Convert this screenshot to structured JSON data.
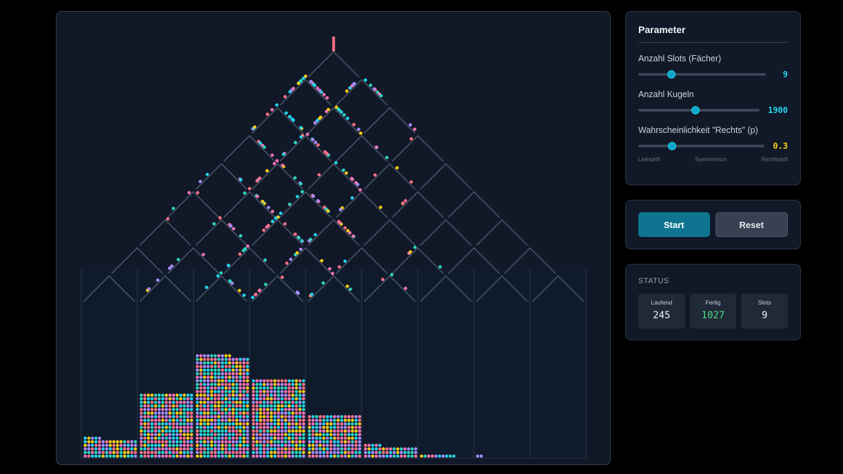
{
  "params": {
    "title": "Parameter",
    "slots": {
      "label": "Anzahl Slots (Fächer)",
      "value": "9",
      "fraction": 0.26
    },
    "balls": {
      "label": "Anzahl Kugeln",
      "value": "1900",
      "fraction": 0.47
    },
    "prob": {
      "label": "Wahrscheinlichkeit \"Rechts\" (p)",
      "value": "0.3",
      "fraction": 0.27
    },
    "drift": {
      "left": "Linksdrift",
      "center": "Symmetrisch",
      "right": "Rechtsdrift"
    }
  },
  "actions": {
    "start": "Start",
    "reset": "Reset"
  },
  "status": {
    "title": "STATUS",
    "running_label": "Laufend",
    "running": "245",
    "done_label": "Fertig",
    "done": "1027",
    "slots_label": "Slots",
    "slots": "9"
  },
  "sim": {
    "slot_counts": [
      80,
      270,
      430,
      330,
      180,
      50,
      10,
      2,
      0
    ],
    "colors": {
      "ball_1": "#f472b6",
      "ball_2": "#22d3ee",
      "ball_3": "#a78bfa",
      "ball_4": "#facc15",
      "ball_5": "#2dd4bf",
      "ball_6": "#fb7185",
      "peg": "#3f4a5c"
    }
  }
}
